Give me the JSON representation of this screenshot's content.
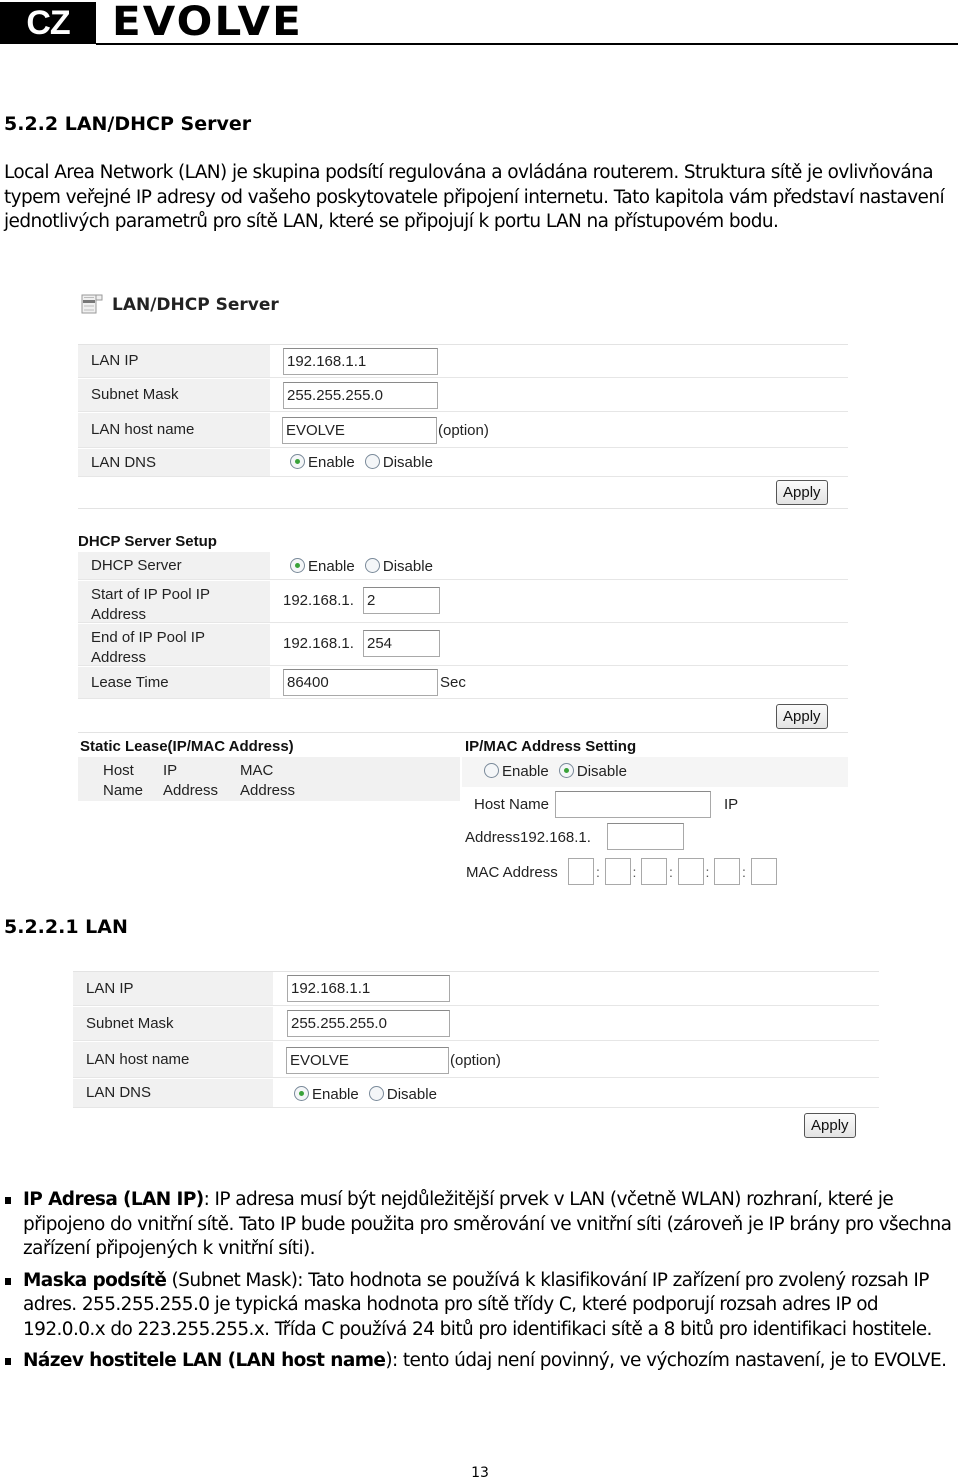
{
  "header": {
    "lang_badge": "CZ",
    "brand": "EVOLVE"
  },
  "section": {
    "heading": "5.2.2 LAN/DHCP Server",
    "intro": "Local Area Network (LAN) je skupina podsítí regulována a ovládána routerem. Struktura sítě je ovlivňována typem veřejné IP adresy od vašeho poskytovatele připojení internetu. Tato kapitola vám představí nastavení jednotlivých parametrů pro sítě LAN, které se připojují k portu LAN na přístupovém bodu."
  },
  "screenshot1": {
    "title": "LAN/DHCP Server",
    "lan": {
      "rows": [
        {
          "label": "LAN IP",
          "value": "192.168.1.1"
        },
        {
          "label": "Subnet Mask",
          "value": "255.255.255.0"
        },
        {
          "label": "LAN host name",
          "value": "EVOLVE",
          "suffix": "(option)"
        },
        {
          "label": "LAN DNS",
          "options": [
            "Enable",
            "Disable"
          ],
          "selected": "Enable"
        }
      ],
      "apply": "Apply"
    },
    "dhcp": {
      "title": "DHCP Server Setup",
      "server_label": "DHCP Server",
      "server_options": [
        "Enable",
        "Disable"
      ],
      "server_selected": "Enable",
      "start_label": "Start of IP Pool IP Address",
      "start_prefix": "192.168.1.",
      "start_value": "2",
      "end_label": "End of IP Pool IP Address",
      "end_prefix": "192.168.1.",
      "end_value": "254",
      "lease_label": "Lease Time",
      "lease_value": "86400",
      "lease_unit": "Sec",
      "apply": "Apply"
    },
    "static_lease": {
      "title": "Static Lease(IP/MAC Address)",
      "columns": [
        "Host Name",
        "IP Address",
        "MAC Address"
      ]
    },
    "ipmac": {
      "title": "IP/MAC Address Setting",
      "options": [
        "Enable",
        "Disable"
      ],
      "selected": "Disable",
      "host_name_label": "Host Name",
      "host_name_value": "",
      "ip_label_part1": "IP",
      "ip_label_part2": "Address192.168.1.",
      "ip_value": "",
      "mac_label": "MAC Address",
      "mac_separator": ":"
    }
  },
  "subsection": {
    "heading": "5.2.2.1 LAN"
  },
  "screenshot2": {
    "rows": [
      {
        "label": "LAN IP",
        "value": "192.168.1.1"
      },
      {
        "label": "Subnet Mask",
        "value": "255.255.255.0"
      },
      {
        "label": "LAN host name",
        "value": "EVOLVE",
        "suffix": "(option)"
      },
      {
        "label": "LAN DNS",
        "options": [
          "Enable",
          "Disable"
        ],
        "selected": "Enable"
      }
    ],
    "apply": "Apply"
  },
  "bullets": [
    {
      "term": "IP Adresa (LAN IP)",
      "text": ": IP adresa musí být nejdůležitější prvek v LAN (včetně WLAN) rozhraní, které je připojeno do vnitřní sítě. Tato IP bude použita pro směrování ve vnitřní síti (zároveň je IP brány pro všechna zařízení připojených k vnitřní síti)."
    },
    {
      "term": "Maska podsítě",
      "term2": " (Subnet Mask",
      "text": "): Tato hodnota se používá k klasifikování IP zařízení pro zvolený rozsah IP adres. 255.255.255.0 je typická maska hodnota pro sítě třídy C, které podporují rozsah adres IP od 192.0.0.x do 223.255.255.x. Třída C používá 24 bitů pro identifikaci sítě a 8 bitů pro identifikaci hostitele."
    },
    {
      "term": "Název hostitele LAN (LAN host name",
      "text": "): tento údaj není povinný, ve výchozím nastavení, je to EVOLVE."
    }
  ],
  "footer": {
    "page_number": "13"
  }
}
